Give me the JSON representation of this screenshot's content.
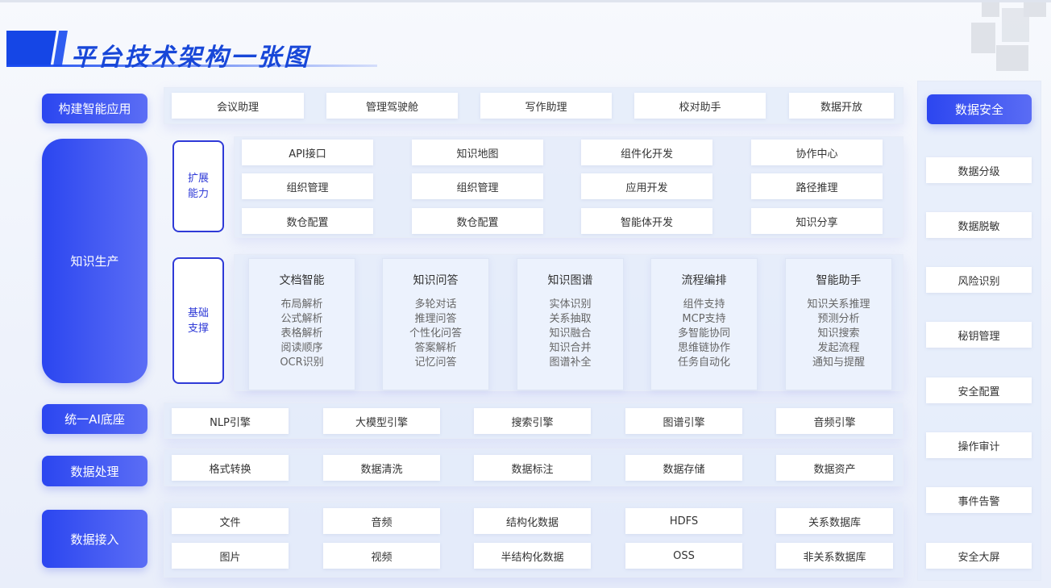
{
  "title": "平台技术架构一张图",
  "left_labels": [
    "构建智能应用",
    "知识生产",
    "统一AI底座",
    "数据处理",
    "数据接入"
  ],
  "app_row": [
    "会议助理",
    "管理驾驶舱",
    "写作助理",
    "校对助手",
    "数据开放"
  ],
  "ext": {
    "tag": "扩展\n能力",
    "rows": [
      [
        "API接口",
        "知识地图",
        "组件化开发",
        "协作中心"
      ],
      [
        "组织管理",
        "组织管理",
        "应用开发",
        "路径推理"
      ],
      [
        "数仓配置",
        "数仓配置",
        "智能体开发",
        "知识分享"
      ]
    ]
  },
  "base": {
    "tag": "基础\n支撑",
    "columns": [
      {
        "title": "文档智能",
        "items": [
          "布局解析",
          "公式解析",
          "表格解析",
          "阅读顺序",
          "OCR识别"
        ]
      },
      {
        "title": "知识问答",
        "items": [
          "多轮对话",
          "推理问答",
          "个性化问答",
          "答案解析",
          "记忆问答"
        ]
      },
      {
        "title": "知识图谱",
        "items": [
          "实体识别",
          "关系抽取",
          "知识融合",
          "知识合并",
          "图谱补全"
        ]
      },
      {
        "title": "流程编排",
        "items": [
          "组件支持",
          "MCP支持",
          "多智能协同",
          "思维链协作",
          "任务自动化"
        ]
      },
      {
        "title": "智能助手",
        "items": [
          "知识关系推理",
          "预测分析",
          "知识搜索",
          "发起流程",
          "通知与提醒"
        ]
      }
    ]
  },
  "ai_row": [
    "NLP引擎",
    "大模型引擎",
    "搜索引擎",
    "图谱引擎",
    "音频引擎"
  ],
  "proc_row": [
    "格式转换",
    "数据清洗",
    "数据标注",
    "数据存储",
    "数据资产"
  ],
  "access_rows": [
    [
      "文件",
      "音频",
      "结构化数据",
      "HDFS",
      "关系数据库"
    ],
    [
      "图片",
      "视频",
      "半结构化数据",
      "OSS",
      "非关系数据库"
    ]
  ],
  "security": {
    "header": "数据安全",
    "items": [
      "数据分级",
      "数据脱敏",
      "风险识别",
      "秘钥管理",
      "安全配置",
      "操作审计",
      "事件告警",
      "安全大屏"
    ]
  },
  "colors": {
    "accent": "#1847d8",
    "label_gradient_start": "#2b46f0",
    "label_gradient_end": "#5b6df5",
    "tag_border": "#2f3ad7"
  }
}
